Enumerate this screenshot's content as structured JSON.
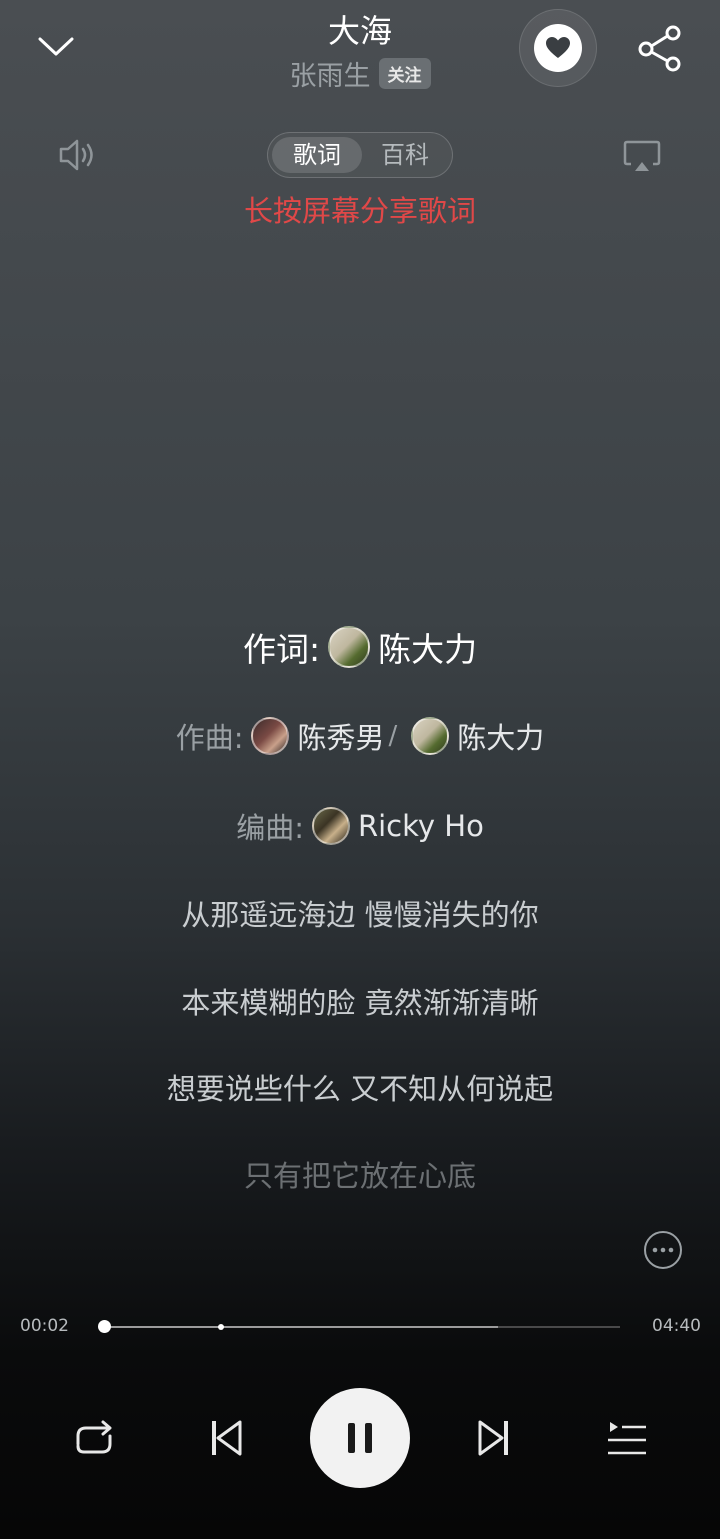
{
  "header": {
    "title": "大海",
    "artist": "张雨生",
    "follow_label": "关注"
  },
  "tabs": [
    {
      "label": "歌词",
      "active": true
    },
    {
      "label": "百科",
      "active": false
    }
  ],
  "share_hint": "长按屏幕分享歌词",
  "credits": {
    "lyricist": {
      "prefix": "作词:",
      "names": [
        "陈大力"
      ]
    },
    "composer": {
      "prefix": "作曲:",
      "names": [
        "陈秀男",
        "陈大力"
      ],
      "separator": "/"
    },
    "arranger": {
      "prefix": "编曲:",
      "names": [
        "Ricky Ho"
      ]
    }
  },
  "lyrics": [
    "从那遥远海边 慢慢消失的你",
    "本来模糊的脸 竟然渐渐清晰",
    "想要说些什么 又不知从何说起",
    "只有把它放在心底"
  ],
  "player": {
    "current_time": "00:02",
    "total_time": "04:40",
    "progress": 0.01,
    "buffered": 0.76
  },
  "colors": {
    "accent_red": "#e04848"
  },
  "icons": [
    "chevron-down-icon",
    "heart-icon",
    "share-icon",
    "volume-icon",
    "cast-icon",
    "more-icon",
    "repeat-icon",
    "previous-icon",
    "pause-icon",
    "next-icon",
    "playlist-icon"
  ]
}
